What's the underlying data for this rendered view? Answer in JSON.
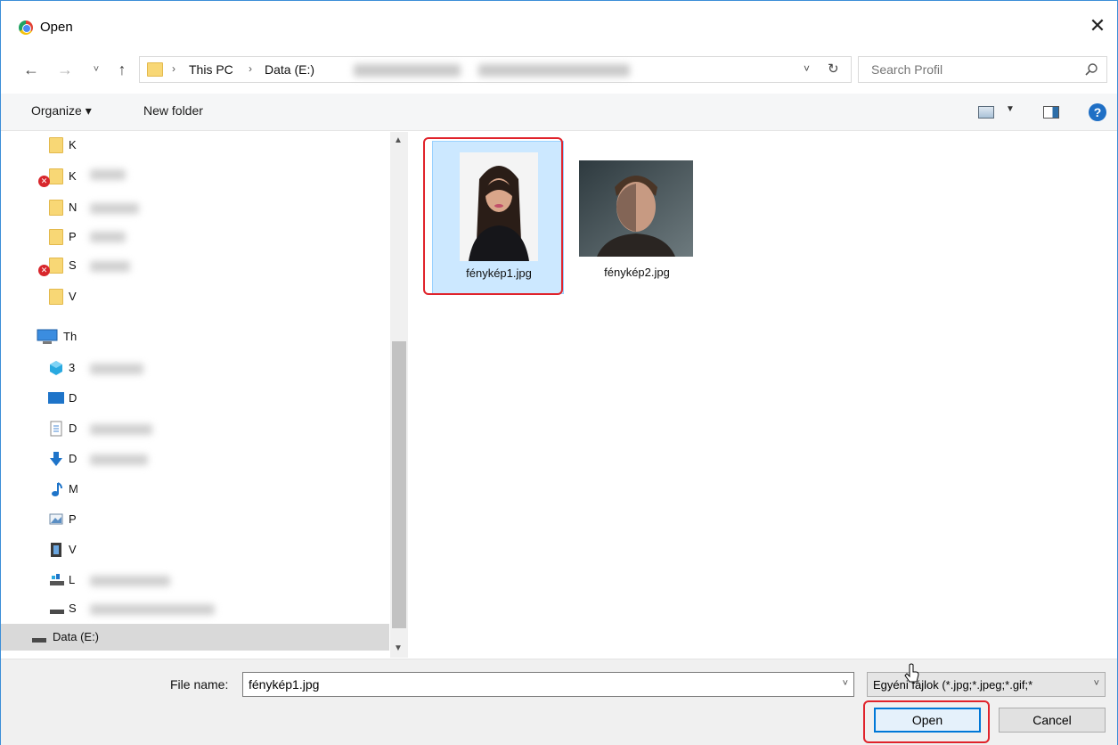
{
  "window": {
    "title": "Open",
    "close_symbol": "✕"
  },
  "navigation": {
    "back_symbol": "←",
    "forward_symbol": "→",
    "recent_symbol": "˅",
    "up_symbol": "↑",
    "breadcrumbs": [
      "This PC",
      "Data (E:)"
    ],
    "crumb_separator": "›",
    "dropdown_symbol": "˅",
    "refresh_symbol": "↻",
    "search_placeholder": "Search Profil"
  },
  "toolbar": {
    "organize_label": "Organize ▾",
    "new_folder_label": "New folder",
    "view_dropdown_symbol": "▼",
    "help_symbol": "?"
  },
  "sidebar": {
    "items": [
      {
        "label": "K",
        "icon": "folder-icon",
        "error": false
      },
      {
        "label": "K",
        "icon": "folder-icon",
        "error": true
      },
      {
        "label": "N",
        "icon": "folder-icon",
        "error": false
      },
      {
        "label": "P",
        "icon": "folder-icon",
        "error": false
      },
      {
        "label": "S",
        "icon": "folder-icon",
        "error": true
      },
      {
        "label": "V",
        "icon": "folder-icon",
        "error": false
      },
      {
        "label": "Th",
        "icon": "this-pc-icon",
        "error": false
      },
      {
        "label": "3",
        "icon": "3d-objects-icon",
        "error": false
      },
      {
        "label": "D",
        "icon": "desktop-icon",
        "error": false
      },
      {
        "label": "D",
        "icon": "documents-icon",
        "error": false
      },
      {
        "label": "D",
        "icon": "downloads-icon",
        "error": false
      },
      {
        "label": "M",
        "icon": "music-icon",
        "error": false
      },
      {
        "label": "P",
        "icon": "pictures-icon",
        "error": false
      },
      {
        "label": "V",
        "icon": "videos-icon",
        "error": false
      },
      {
        "label": "L",
        "icon": "network-drive-icon",
        "error": false
      },
      {
        "label": "S",
        "icon": "drive-icon",
        "error": false
      },
      {
        "label": "Data (E:)",
        "icon": "drive-icon",
        "error": false
      }
    ],
    "error_symbol": "✕",
    "scroll_up_symbol": "▲",
    "scroll_down_symbol": "▼"
  },
  "files": [
    {
      "name": "fénykép1.jpg",
      "selected": true
    },
    {
      "name": "fénykép2.jpg",
      "selected": false
    }
  ],
  "footer": {
    "file_name_label": "File name:",
    "file_name_value": "fénykép1.jpg",
    "dropdown_symbol": "˅",
    "file_type": "Egyéni fájlok (*.jpg;*.jpeg;*.gif;*",
    "open_label": "Open",
    "cancel_label": "Cancel"
  },
  "colors": {
    "accent": "#0078d7",
    "highlight": "#e0232b",
    "selection": "#cce8ff",
    "folder": "#f8d775"
  }
}
